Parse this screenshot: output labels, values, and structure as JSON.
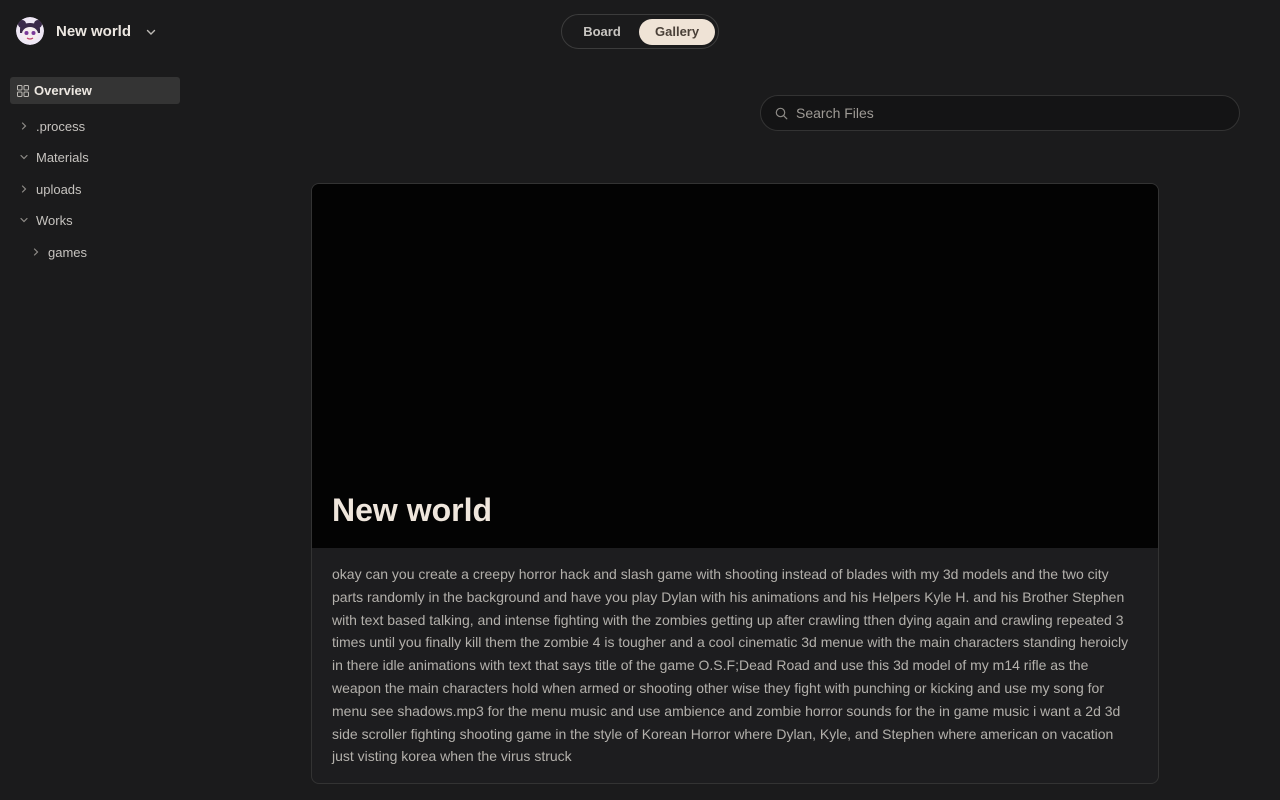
{
  "workspace": {
    "name": "New world"
  },
  "sidebar": {
    "overview_label": "Overview",
    "items": [
      {
        "label": ".process",
        "expanded": false
      },
      {
        "label": "Materials",
        "expanded": true
      },
      {
        "label": "uploads",
        "expanded": false
      },
      {
        "label": "Works",
        "expanded": true
      },
      {
        "label": "games",
        "expanded": false
      }
    ]
  },
  "view_toggle": {
    "board_label": "Board",
    "gallery_label": "Gallery",
    "active": "Gallery"
  },
  "search": {
    "placeholder": "Search Files",
    "value": ""
  },
  "card": {
    "title": "New world",
    "description": "okay can you create a creepy horror hack and slash game with shooting instead of blades with my 3d models and the two city parts randomly in the background and have you play Dylan with his animations and his Helpers Kyle H. and his Brother Stephen with text based talking, and intense fighting with the zombies getting up after crawling tthen dying again and crawling repeated 3 times until you finally kill them the zombie 4 is tougher and a cool cinematic 3d menue with the main characters standing heroicly in there idle animations with text that says title of the game O.S.F;Dead Road and use this 3d model of my m14 rifle as the weapon the main characters hold when armed or shooting other wise they fight with punching or kicking and use my song for menu see shadows.mp3 for the menu music and use ambience and zombie horror sounds for the in game music i want a 2d 3d side scroller fighting shooting game in the style of Korean Horror where Dylan, Kyle, and Stephen where american on vacation just visting korea when the virus struck"
  },
  "colors": {
    "background": "#1b1b1c",
    "toggle_active": "#efe3d6",
    "cover": "#030303"
  },
  "icons": {
    "avatar": "avatar-icon",
    "workspace_chevron": "chevron-down-icon",
    "overview": "grid-icon",
    "search": "search-icon"
  }
}
